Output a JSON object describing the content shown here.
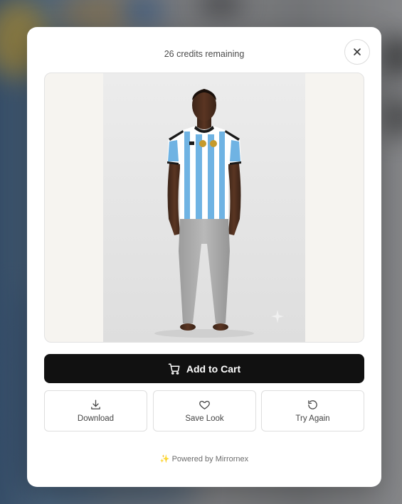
{
  "modal": {
    "credits_text": "26 credits remaining",
    "close_icon": "close-icon",
    "image": {
      "alt": "Try-on result: man wearing Argentina jersey and grey trousers"
    },
    "primary_action": {
      "label": "Add to Cart",
      "icon": "cart-icon"
    },
    "actions": [
      {
        "label": "Download",
        "icon": "download-icon"
      },
      {
        "label": "Save Look",
        "icon": "heart-icon"
      },
      {
        "label": "Try Again",
        "icon": "refresh-icon"
      }
    ],
    "footer": "✨ Powered by Mirrornex"
  },
  "colors": {
    "primary_button": "#111111",
    "modal_bg": "#ffffff",
    "image_bg": "#f6f4f0"
  }
}
